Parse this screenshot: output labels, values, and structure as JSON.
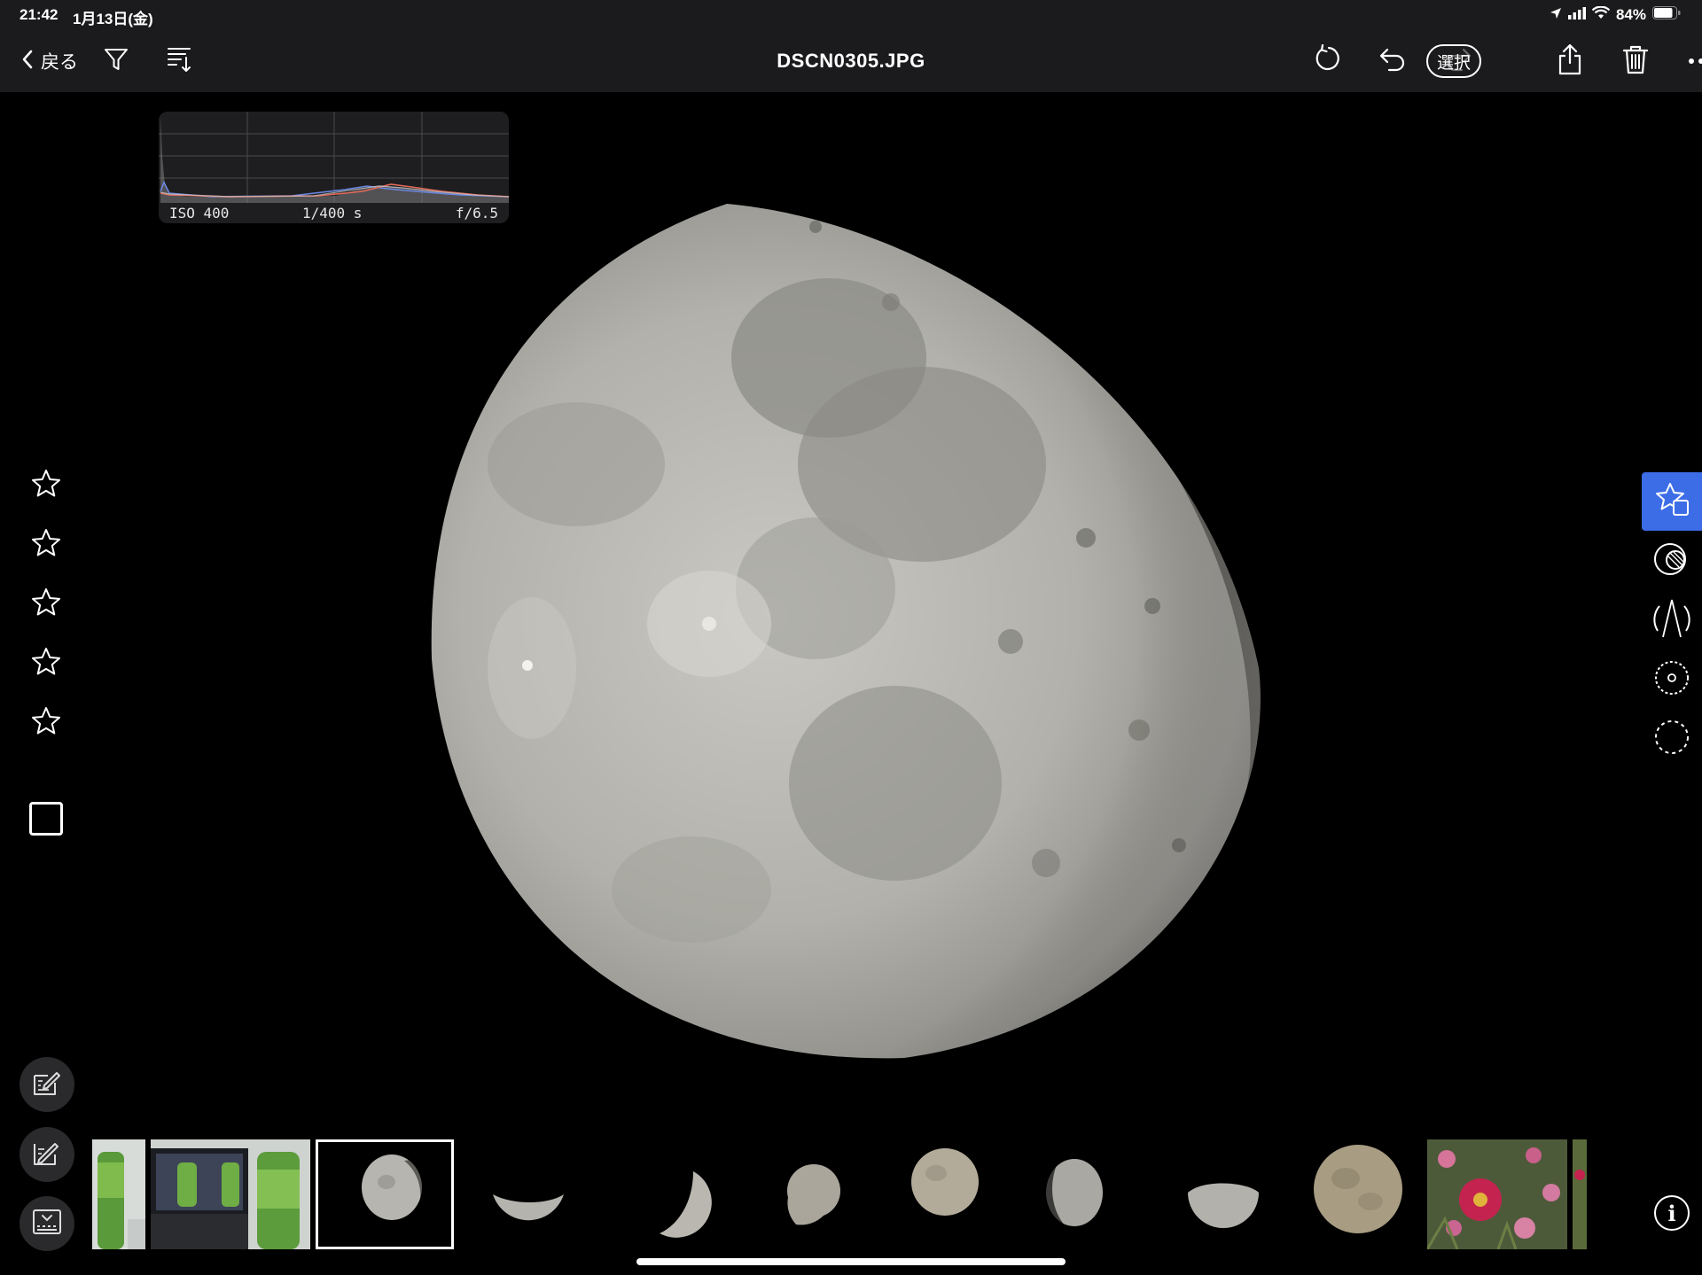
{
  "status_bar": {
    "time": "21:42",
    "date": "1月13日(金)",
    "battery": "84%"
  },
  "navbar": {
    "back_label": "戻る",
    "title": "DSCN0305.JPG",
    "select_label": "選択"
  },
  "histogram": {
    "iso": "ISO 400",
    "shutter": "1/400 s",
    "aperture": "f/6.5"
  },
  "left_rail": {
    "star_count": 5,
    "rating": 0,
    "flagged": false
  },
  "right_tools": {
    "active": "rating-tool"
  },
  "filmstrip": {
    "selected_index": 2
  },
  "colors": {
    "accent": "#3d6de6",
    "bar_bg": "#1b1b1d"
  }
}
